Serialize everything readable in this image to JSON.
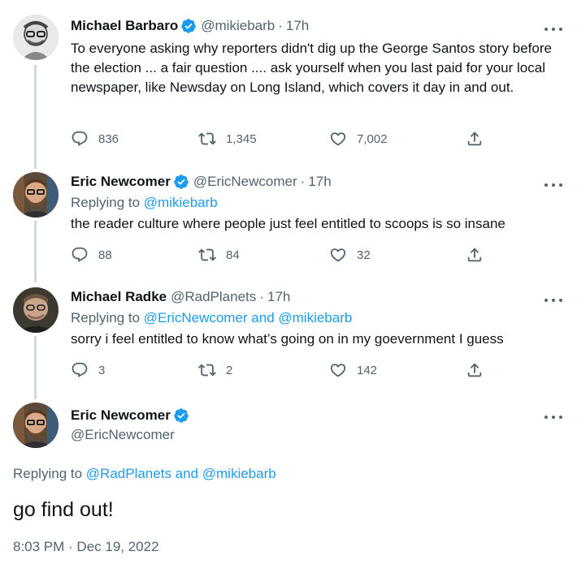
{
  "tweets": [
    {
      "name": "Michael Barbaro",
      "verified": true,
      "handle": "@mikiebarb",
      "time": "17h",
      "text": "To everyone asking why reporters didn't dig up the George Santos story before the election ... a fair question .... ask yourself when you last paid for your local newspaper, like Newsday on Long Island, which covers it day in and out.",
      "replies": "836",
      "retweets": "1,345",
      "likes": "7,002"
    },
    {
      "name": "Eric Newcomer",
      "verified": true,
      "handle": "@EricNewcomer",
      "time": "17h",
      "replying_prefix": "Replying to",
      "replying_to": "@mikiebarb",
      "text": "the reader culture where people just feel entitled to scoops is so insane",
      "replies": "88",
      "retweets": "84",
      "likes": "32"
    },
    {
      "name": "Michael Radke",
      "verified": false,
      "handle": "@RadPlanets",
      "time": "17h",
      "replying_prefix": "Replying to",
      "replying_to": "@EricNewcomer and @mikiebarb",
      "text": "sorry i feel entitled to know what’s going on in my goevernment I guess",
      "replies": "3",
      "retweets": "2",
      "likes": "142"
    }
  ],
  "main_tweet": {
    "name": "Eric Newcomer",
    "verified": true,
    "handle": "@EricNewcomer",
    "replying_prefix": "Replying to",
    "replying_to": "@RadPlanets and @mikiebarb",
    "text": "go find out!",
    "timestamp": "8:03 PM · Dec 19, 2022"
  },
  "icons": {
    "reply": "reply-icon",
    "retweet": "retweet-icon",
    "like": "like-icon",
    "share": "share-icon",
    "more": "more-icon",
    "verified": "verified-badge-icon"
  },
  "colors": {
    "text": "#0f1419",
    "secondary": "#536471",
    "link": "#1d9bf0",
    "verified": "#1d9bf0",
    "thread_line": "#cfd9de"
  }
}
